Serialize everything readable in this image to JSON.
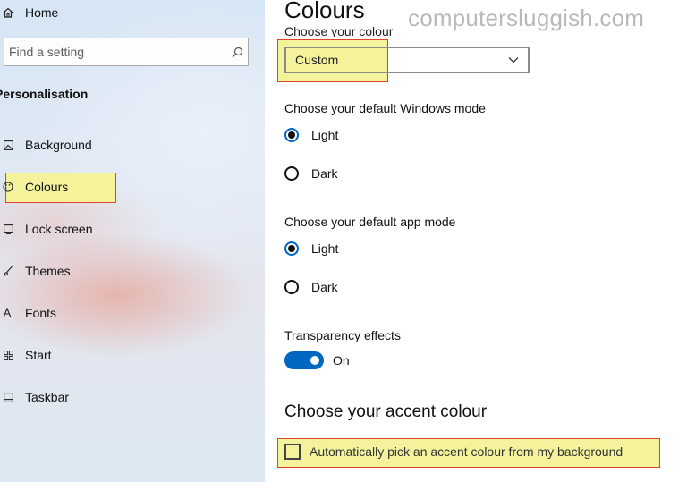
{
  "sidebar": {
    "home_label": "Home",
    "search": {
      "placeholder": "Find a setting"
    },
    "section_title": "Personalisation",
    "items": [
      {
        "label": "Background",
        "icon": "picture-icon"
      },
      {
        "label": "Colours",
        "icon": "palette-icon"
      },
      {
        "label": "Lock screen",
        "icon": "lock-screen-icon"
      },
      {
        "label": "Themes",
        "icon": "brush-icon"
      },
      {
        "label": "Fonts",
        "icon": "font-icon"
      },
      {
        "label": "Start",
        "icon": "start-grid-icon"
      },
      {
        "label": "Taskbar",
        "icon": "taskbar-icon"
      }
    ]
  },
  "main": {
    "title": "Colours",
    "watermark": "computersluggish.com",
    "choose_colour_label": "Choose your colour",
    "colour_dropdown_value": "Custom",
    "windows_mode": {
      "heading": "Choose your default Windows mode",
      "options": [
        "Light",
        "Dark"
      ],
      "selected": "Light"
    },
    "app_mode": {
      "heading": "Choose your default app mode",
      "options": [
        "Light",
        "Dark"
      ],
      "selected": "Light"
    },
    "transparency": {
      "heading": "Transparency effects",
      "state_label": "On"
    },
    "accent": {
      "heading": "Choose your accent colour",
      "auto_pick_label": "Automatically pick an accent colour from my background"
    }
  },
  "colors": {
    "accent_blue": "#0067c0",
    "highlight_yellow": "#f4f39c",
    "highlight_border_red": "#e2412c"
  }
}
